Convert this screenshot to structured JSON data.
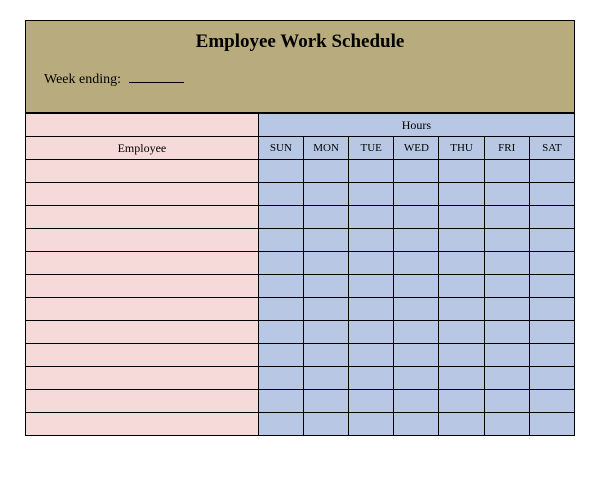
{
  "title": "Employee Work Schedule",
  "week_ending_label": "Week ending:",
  "week_ending_value": "",
  "hours_header": "Hours",
  "employee_header": "Employee",
  "days": [
    "SUN",
    "MON",
    "TUE",
    "WED",
    "THU",
    "FRI",
    "SAT"
  ],
  "rows": [
    {
      "employee": "",
      "hours": [
        "",
        "",
        "",
        "",
        "",
        "",
        ""
      ]
    },
    {
      "employee": "",
      "hours": [
        "",
        "",
        "",
        "",
        "",
        "",
        ""
      ]
    },
    {
      "employee": "",
      "hours": [
        "",
        "",
        "",
        "",
        "",
        "",
        ""
      ]
    },
    {
      "employee": "",
      "hours": [
        "",
        "",
        "",
        "",
        "",
        "",
        ""
      ]
    },
    {
      "employee": "",
      "hours": [
        "",
        "",
        "",
        "",
        "",
        "",
        ""
      ]
    },
    {
      "employee": "",
      "hours": [
        "",
        "",
        "",
        "",
        "",
        "",
        ""
      ]
    },
    {
      "employee": "",
      "hours": [
        "",
        "",
        "",
        "",
        "",
        "",
        ""
      ]
    },
    {
      "employee": "",
      "hours": [
        "",
        "",
        "",
        "",
        "",
        "",
        ""
      ]
    },
    {
      "employee": "",
      "hours": [
        "",
        "",
        "",
        "",
        "",
        "",
        ""
      ]
    },
    {
      "employee": "",
      "hours": [
        "",
        "",
        "",
        "",
        "",
        "",
        ""
      ]
    },
    {
      "employee": "",
      "hours": [
        "",
        "",
        "",
        "",
        "",
        "",
        ""
      ]
    },
    {
      "employee": "",
      "hours": [
        "",
        "",
        "",
        "",
        "",
        "",
        ""
      ]
    }
  ]
}
